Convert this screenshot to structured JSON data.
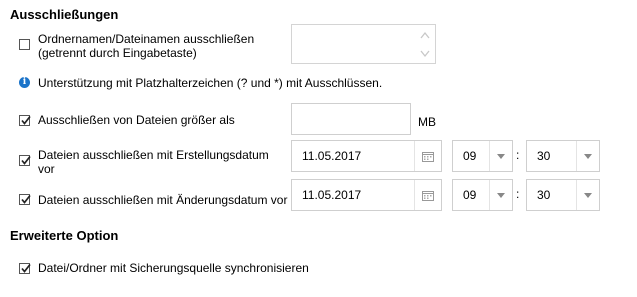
{
  "sections": {
    "exclusions_title": "Ausschließungen",
    "advanced_title": "Erweiterte Option"
  },
  "exclude_names": {
    "label_line1": "Ordnernamen/Dateinamen ausschließen",
    "label_line2": "(getrennt durch Eingabetaste)",
    "checked": false,
    "value": ""
  },
  "wildcard_info": "Unterstützung mit Platzhalterzeichen (? und *) mit Ausschlüssen.",
  "exclude_size": {
    "label": "Ausschließen von Dateien größer als",
    "checked": true,
    "value": "",
    "unit": "MB"
  },
  "exclude_created": {
    "label_line1": "Dateien ausschließen mit Erstellungsdatum",
    "label_line2": "vor",
    "checked": true,
    "date": "11.05.2017",
    "hour": "09",
    "minute": "30"
  },
  "exclude_modified": {
    "label": "Dateien ausschließen mit Änderungsdatum vor",
    "checked": true,
    "date": "11.05.2017",
    "hour": "09",
    "minute": "30"
  },
  "sync_option": {
    "label": "Datei/Ordner mit Sicherungsquelle synchronisieren",
    "checked": true
  },
  "time_separator": ":",
  "icons": {
    "checkbox_check": "check-icon",
    "calendar": "calendar-icon",
    "dropdown": "chevron-down-icon",
    "info": "info-icon",
    "spinner": "spinner-arrows-icon"
  },
  "colors": {
    "info_blue": "#1a73c9",
    "border": "#cfcfcf"
  }
}
